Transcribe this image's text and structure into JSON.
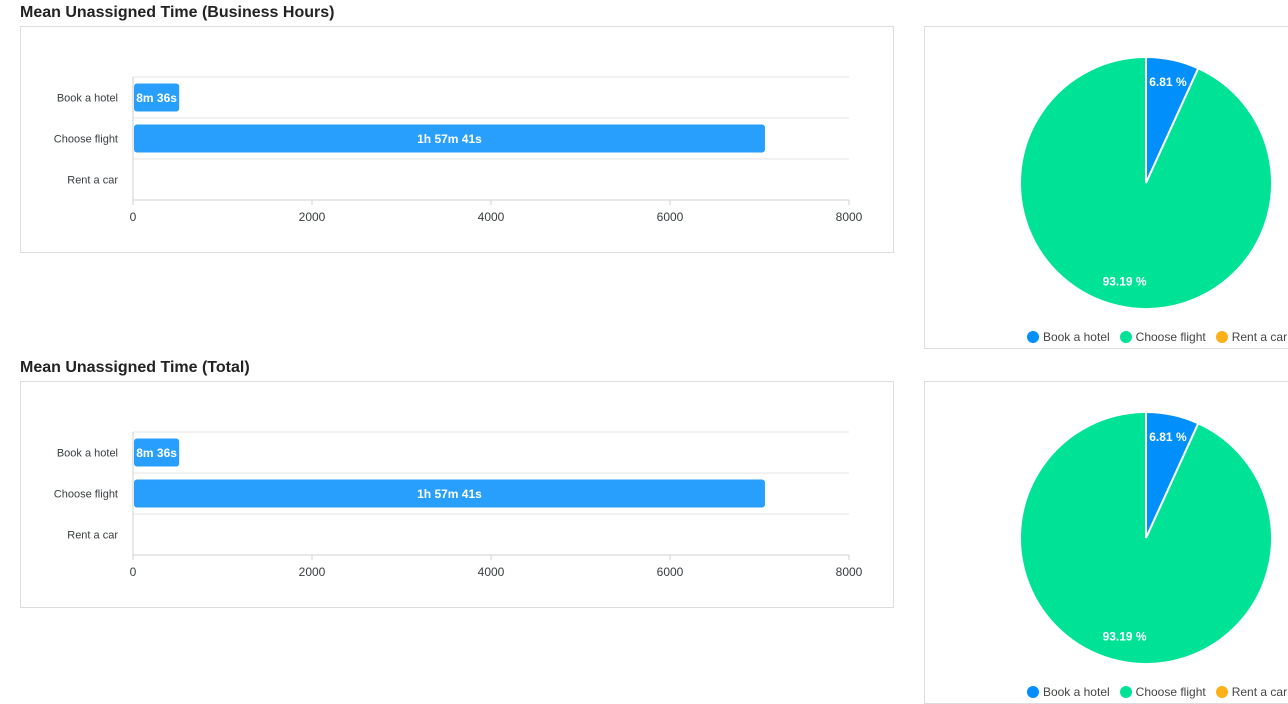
{
  "sections": [
    {
      "title": "Mean Unassigned Time (Business Hours)",
      "bar_chart": {
        "type": "bar",
        "orientation": "horizontal",
        "categories": [
          "Book a hotel",
          "Choose flight",
          "Rent a car"
        ],
        "values": [
          516,
          7061,
          0
        ],
        "data_labels": [
          "8m 36s",
          "1h 57m 41s",
          ""
        ],
        "xlim": [
          0,
          8000
        ],
        "xticks": [
          "0",
          "2000",
          "4000",
          "6000",
          "8000"
        ]
      },
      "pie_chart": {
        "type": "pie",
        "labels": [
          "Book a hotel",
          "Choose flight",
          "Rent a car"
        ],
        "values": [
          6.81,
          93.19,
          0
        ],
        "data_labels": [
          "6.81 %",
          "93.19 %",
          ""
        ],
        "colors": [
          "#008ffb",
          "#00e396",
          "#feb019"
        ],
        "legend_position": "bottom"
      }
    },
    {
      "title": "Mean Unassigned Time (Total)",
      "bar_chart": {
        "type": "bar",
        "orientation": "horizontal",
        "categories": [
          "Book a hotel",
          "Choose flight",
          "Rent a car"
        ],
        "values": [
          516,
          7061,
          0
        ],
        "data_labels": [
          "8m 36s",
          "1h 57m 41s",
          ""
        ],
        "xlim": [
          0,
          8000
        ],
        "xticks": [
          "0",
          "2000",
          "4000",
          "6000",
          "8000"
        ]
      },
      "pie_chart": {
        "type": "pie",
        "labels": [
          "Book a hotel",
          "Choose flight",
          "Rent a car"
        ],
        "values": [
          6.81,
          93.19,
          0
        ],
        "data_labels": [
          "6.81 %",
          "93.19 %",
          ""
        ],
        "colors": [
          "#008ffb",
          "#00e396",
          "#feb019"
        ],
        "legend_position": "bottom"
      }
    }
  ],
  "bar_color": "#289efd",
  "chart_data": [
    {
      "type": "bar",
      "title": "Mean Unassigned Time (Business Hours)",
      "categories": [
        "Book a hotel",
        "Choose flight",
        "Rent a car"
      ],
      "values": [
        516,
        7061,
        0
      ],
      "xlim": [
        0,
        8000
      ]
    },
    {
      "type": "pie",
      "labels": [
        "Book a hotel",
        "Choose flight",
        "Rent a car"
      ],
      "values": [
        6.81,
        93.19,
        0
      ]
    },
    {
      "type": "bar",
      "title": "Mean Unassigned Time (Total)",
      "categories": [
        "Book a hotel",
        "Choose flight",
        "Rent a car"
      ],
      "values": [
        516,
        7061,
        0
      ],
      "xlim": [
        0,
        8000
      ]
    },
    {
      "type": "pie",
      "labels": [
        "Book a hotel",
        "Choose flight",
        "Rent a car"
      ],
      "values": [
        6.81,
        93.19,
        0
      ]
    }
  ]
}
